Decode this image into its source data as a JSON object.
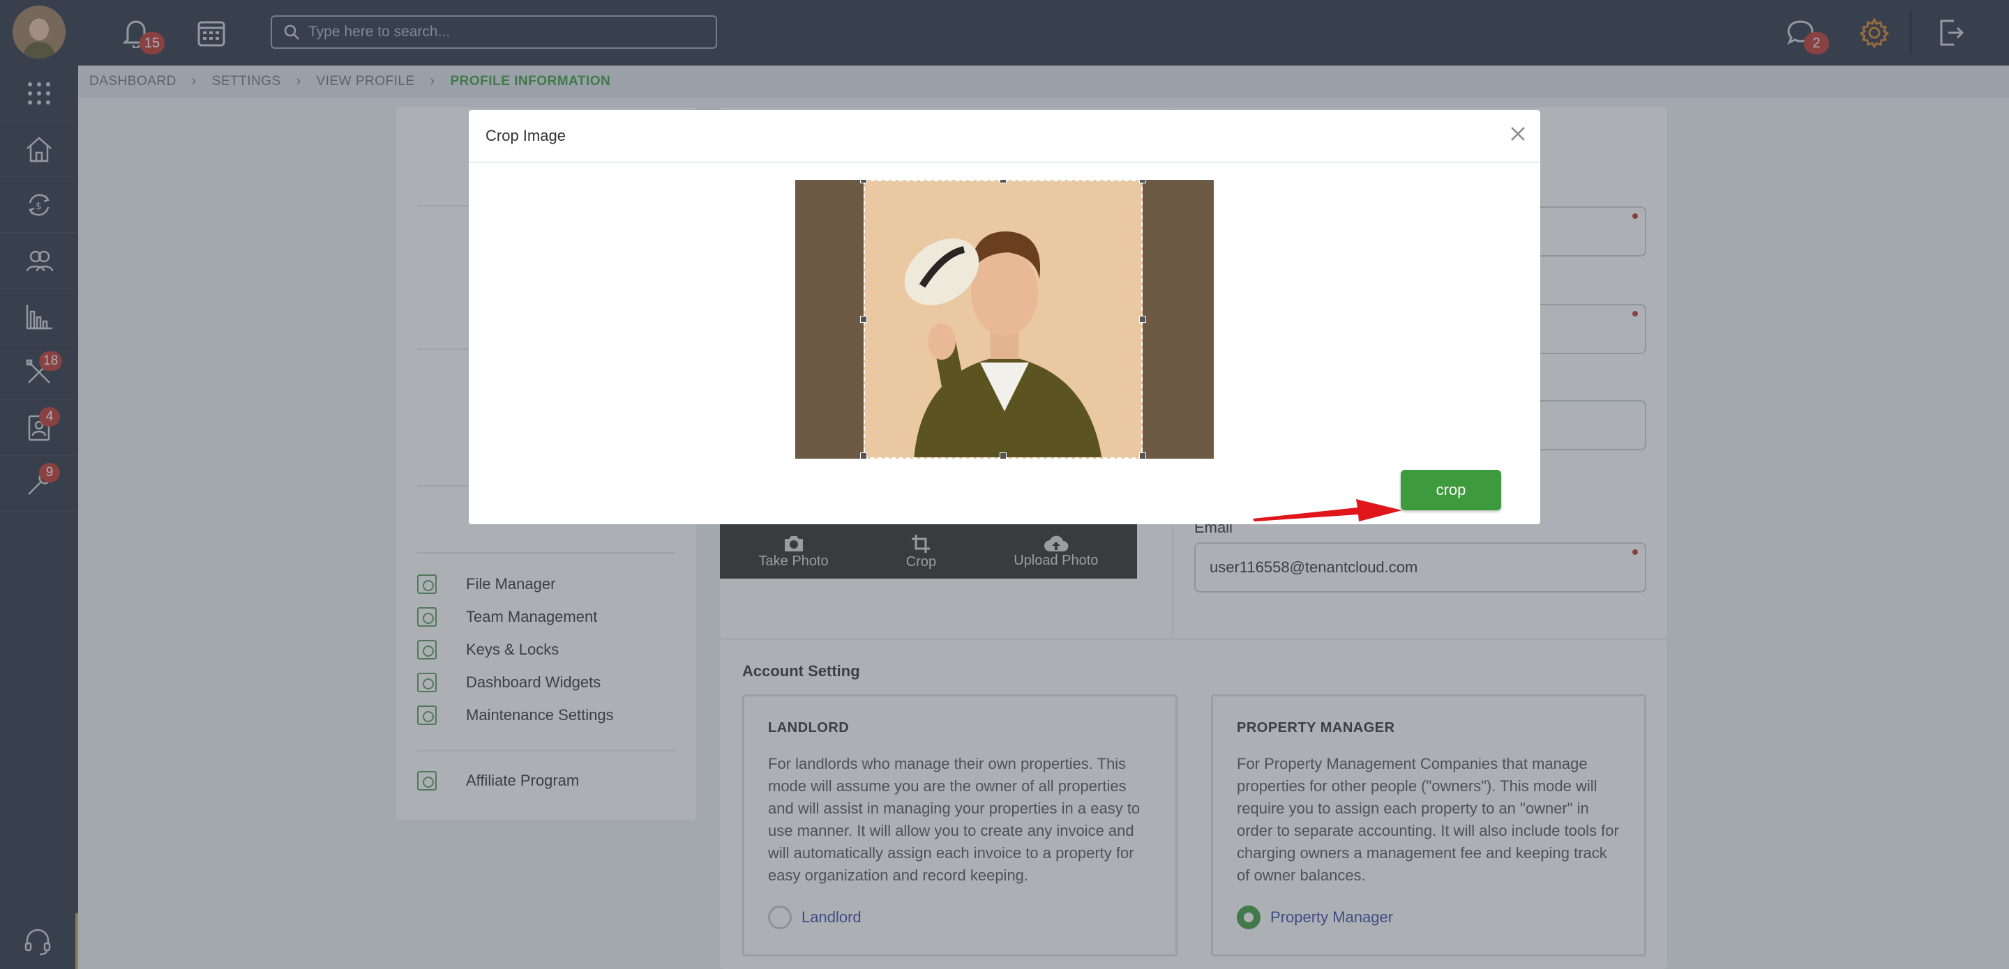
{
  "topbar": {
    "notifications_count": "15",
    "search_placeholder": "Type here to search...",
    "messages_count": "2"
  },
  "sidebar": {
    "maintenance_badge": "18",
    "applications_badge": "4",
    "tools_badge": "9"
  },
  "breadcrumb": {
    "items": [
      "DASHBOARD",
      "SETTINGS",
      "VIEW PROFILE",
      "PROFILE INFORMATION"
    ]
  },
  "settings_menu": {
    "items": [
      {
        "label": "File Manager",
        "icon": "folder-icon"
      },
      {
        "label": "Team Management",
        "icon": "team-icon"
      },
      {
        "label": "Keys & Locks",
        "icon": "key-icon"
      },
      {
        "label": "Dashboard Widgets",
        "icon": "widgets-icon"
      },
      {
        "label": "Maintenance Settings",
        "icon": "gear-icon"
      }
    ],
    "affiliate_label": "Affiliate Program"
  },
  "profile_photo": {
    "take_photo_label": "Take Photo",
    "crop_label": "Crop",
    "upload_photo_label": "Upload Photo"
  },
  "profile_form": {
    "email_label": "Email",
    "email_value": "user116558@tenantcloud.com"
  },
  "account_setting": {
    "title": "Account Setting",
    "landlord": {
      "heading": "LANDLORD",
      "description": "For landlords who manage their own properties. This mode will assume you are the owner of all properties and will assist in managing your properties in a easy to use manner. It will allow you to create any invoice and will automatically assign each invoice to a property for easy organization and record keeping.",
      "option_label": "Landlord",
      "selected": false
    },
    "property_manager": {
      "heading": "PROPERTY MANAGER",
      "description": "For Property Management Companies that manage properties for other people (\"owners\"). This mode will require you to assign each property to an \"owner\" in order to separate accounting. It will also include tools for charging owners a management fee and keeping track of owner balances.",
      "option_label": "Property Manager",
      "selected": true
    }
  },
  "modal": {
    "title": "Crop Image",
    "crop_button_label": "crop"
  },
  "colors": {
    "topbar": "#2b3440",
    "accent_green": "#3e9b3d",
    "badge_red": "#c0362f",
    "link_blue": "#3b4aa8"
  }
}
